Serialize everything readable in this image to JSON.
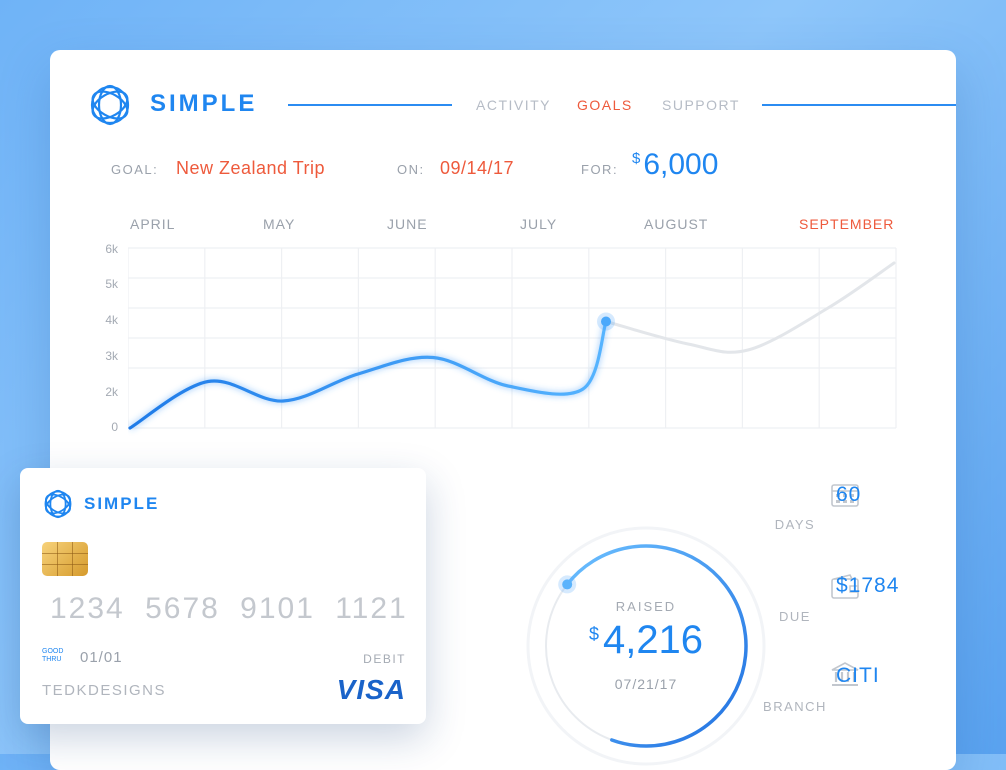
{
  "app": {
    "brand": "SIMPLE"
  },
  "nav": {
    "items": [
      "ACTIVITY",
      "GOALS",
      "SUPPORT"
    ],
    "active": "GOALS"
  },
  "goal": {
    "goal_label": "GOAL:",
    "goal_value": "New Zealand Trip",
    "on_label": "ON:",
    "on_value": "09/14/17",
    "for_label": "FOR:",
    "for_currency": "$",
    "for_value": "6,000"
  },
  "chart_data": {
    "type": "line",
    "categories": [
      "APRIL",
      "MAY",
      "JUNE",
      "JULY",
      "AUGUST",
      "SEPTEMBER"
    ],
    "highlighted_category": "SEPTEMBER",
    "y_ticks": [
      "0",
      "2k",
      "3k",
      "4k",
      "5k",
      "6k"
    ],
    "ylim": [
      0,
      6000
    ],
    "grid": true,
    "series": [
      {
        "values": [
          0,
          1550,
          900,
          1800,
          2350,
          1400,
          1300,
          3550
        ]
      },
      {
        "values": [
          3550,
          2800,
          2600,
          4000,
          5500
        ]
      }
    ],
    "colors": {
      "raised": "#2b8cf2",
      "projected": "#e3e6ea"
    }
  },
  "card": {
    "brand": "SIMPLE",
    "number": "1234 5678 9101 1121",
    "good_thru_label": "GOOD THRU",
    "expiry": "01/01",
    "type": "DEBIT",
    "holder": "TEDKDESIGNS",
    "network": "VISA"
  },
  "raised": {
    "label": "RAISED",
    "currency": "$",
    "amount": "4,216",
    "date": "07/21/17",
    "progress_fraction": 0.7
  },
  "stats": [
    {
      "icon": "calendar-icon",
      "label": "DAYS",
      "value": "60"
    },
    {
      "icon": "wallet-icon",
      "label": "DUE",
      "value": "$1784"
    },
    {
      "icon": "bank-icon",
      "label": "BRANCH",
      "value": "CITI"
    }
  ]
}
